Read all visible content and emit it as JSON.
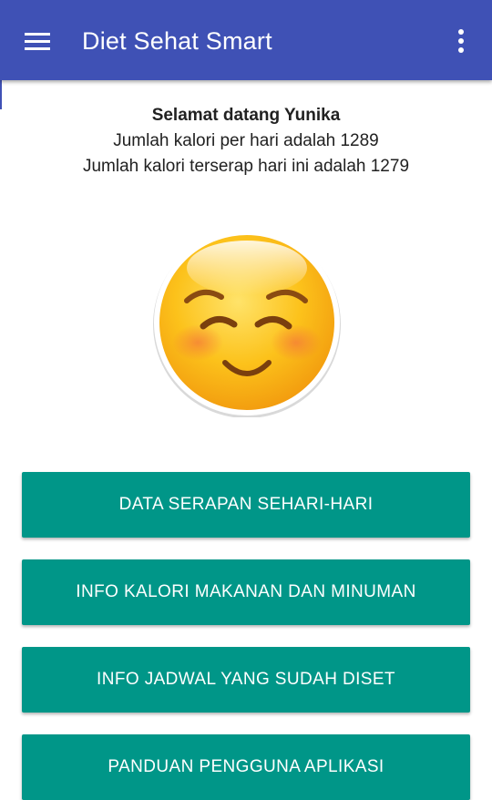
{
  "appbar": {
    "title": "Diet Sehat Smart",
    "menu_icon": "hamburger-menu-icon",
    "overflow_icon": "more-vert-icon",
    "color": "#3f51b5"
  },
  "greeting": {
    "welcome": "Selamat datang Yunika",
    "daily_calories": "Jumlah kalori per hari adalah 1289",
    "absorbed_calories": "Jumlah kalori terserap hari ini adalah 1279"
  },
  "mood_icon": "smiling-face-emoji-icon",
  "buttons": [
    {
      "label": "DATA SERAPAN SEHARI-HARI"
    },
    {
      "label": "INFO KALORI MAKANAN DAN MINUMAN"
    },
    {
      "label": "INFO JADWAL YANG SUDAH DISET"
    },
    {
      "label": "PANDUAN PENGGUNA APLIKASI"
    }
  ],
  "button_color": "#009688"
}
